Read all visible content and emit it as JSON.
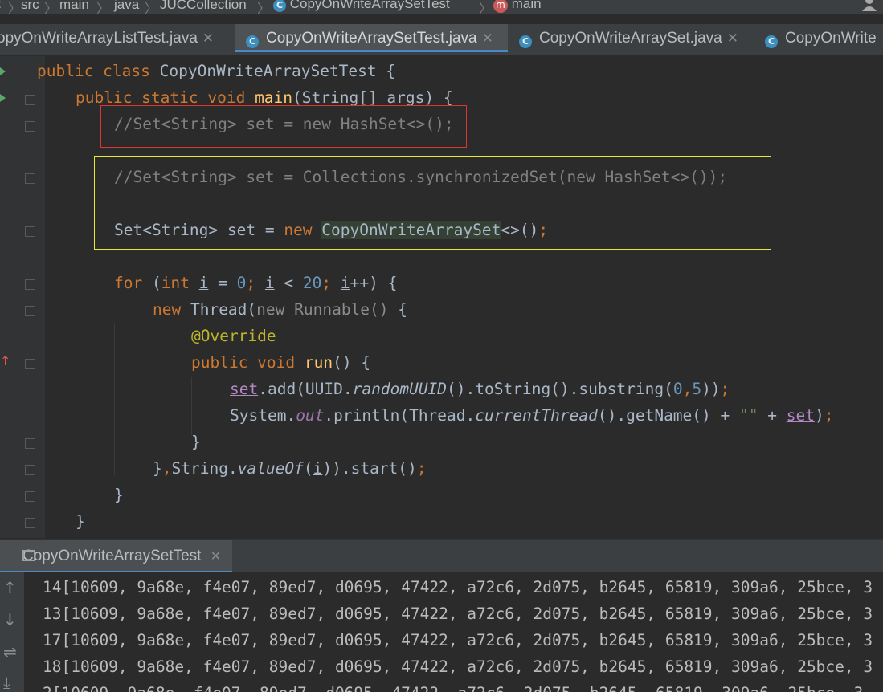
{
  "breadcrumb": [
    "src",
    "main",
    "java",
    "JUCCollection",
    "CopyOnWriteArraySetTest",
    "main"
  ],
  "tabs": [
    {
      "label": "opyOnWriteArrayListTest.java",
      "closable": true
    },
    {
      "label": "CopyOnWriteArraySetTest.java",
      "closable": true,
      "active": true
    },
    {
      "label": "CopyOnWriteArraySet.java",
      "closable": true
    },
    {
      "label": "CopyOnWrite",
      "closable": false
    }
  ],
  "code": {
    "l1_kw": "public class ",
    "l1_cls": "CopyOnWriteArraySetTest {",
    "l2_kw": "public static void ",
    "l2_fn": "main",
    "l2_rest": "(String[] args) {",
    "l3": "//Set<String> set = new HashSet<>();",
    "l4": "//Set<String> set = Collections.synchronizedSet(new HashSet<>());",
    "l5_a": "Set<String> set = ",
    "l5_kw": "new ",
    "l5_cls": "CopyOnWriteArraySet",
    "l5_b": "<>()",
    "l5_semi": ";",
    "l6_for": "for ",
    "l6_p": "(",
    "l6_int": "int ",
    "l6_i": "i",
    "l6_eq": " = ",
    "l6_zero": "0",
    "l6_semi1": "; ",
    "l6_lt": " < ",
    "l6_twenty": "20",
    "l6_semi2": "; ",
    "l6_inc": "++) {",
    "l7_new": "new ",
    "l7_thread": "Thread(",
    "l7_anon": "new Runnable() ",
    "l7_brace": "{",
    "l8": "@Override",
    "l9_kw": "public void ",
    "l9_fn": "run",
    "l9_rest": "() {",
    "l10_set": "set",
    "l10_a": ".add(UUID.",
    "l10_uuid": "randomUUID",
    "l10_b": "().toString().substring(",
    "l10_zero": "0",
    "l10_comma": ",",
    "l10_five": "5",
    "l10_c": "))",
    "l10_semi": ";",
    "l11_a": "System.",
    "l11_out": "out",
    "l11_b": ".println(Thread.",
    "l11_ct": "currentThread",
    "l11_c": "().getName() + ",
    "l11_str": "\"\"",
    "l11_plus": " + ",
    "l11_set": "set",
    "l11_d": ")",
    "l11_semi": ";",
    "l12": "}",
    "l13_a": "}",
    "l13_comma": ",",
    "l13_b": "String.",
    "l13_vo": "valueOf",
    "l13_p": "(",
    "l13_i": "i",
    "l13_c": ")).start()",
    "l13_semi": ";",
    "l14": "}",
    "l15": "}"
  },
  "run_panel": {
    "tab_label": "CopyOnWriteArraySetTest"
  },
  "console_lines": [
    "14[10609, 9a68e, f4e07, 89ed7, d0695, 47422, a72c6, 2d075, b2645, 65819, 309a6, 25bce, 3",
    "13[10609, 9a68e, f4e07, 89ed7, d0695, 47422, a72c6, 2d075, b2645, 65819, 309a6, 25bce, 3",
    "17[10609, 9a68e, f4e07, 89ed7, d0695, 47422, a72c6, 2d075, b2645, 65819, 309a6, 25bce, 3",
    "18[10609, 9a68e, f4e07, 89ed7, d0695, 47422, a72c6, 2d075, b2645, 65819, 309a6, 25bce, 3",
    "2[10609, 9a68e, f4e07, 89ed7, d0695, 47422, a72c6, 2d075, b2645, 65819, 309a6, 25bce, 3"
  ],
  "highlight_colors": {
    "red_box": "#e0342f",
    "yellow_box": "#e8e830"
  }
}
